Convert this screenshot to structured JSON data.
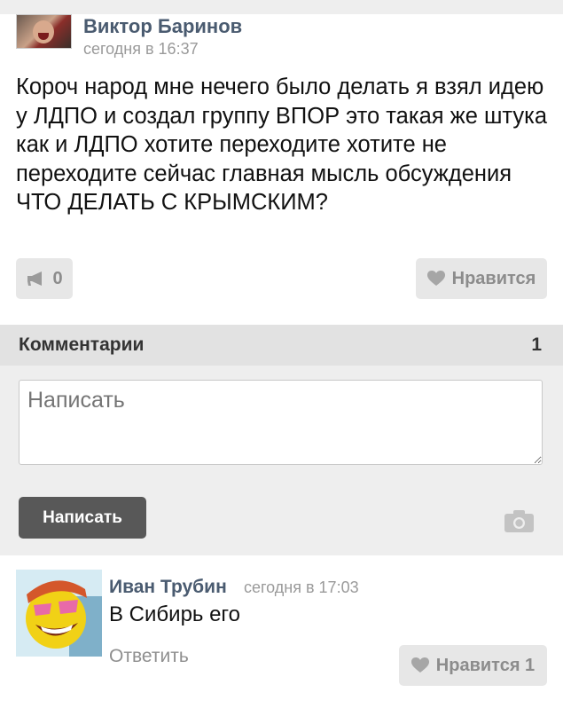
{
  "post": {
    "author": "Виктор Баринов",
    "time": "сегодня в 16:37",
    "text": "Короч народ мне нечего было делать я взял идею у ЛДПО и создал группу ВПОР это такая же штука как и ЛДПО хотите переходите хотите не переходите сейчас главная мысль обсуждения ЧТО ДЕЛАТЬ С КРЫМСКИМ?",
    "share_count": "0",
    "like_label": "Нравится",
    "icons": {
      "share": "megaphone-icon",
      "like": "heart-icon"
    }
  },
  "comments": {
    "title": "Комментарии",
    "count": "1",
    "input_placeholder": "Написать",
    "submit_label": "Написать",
    "attach_icon": "camera-icon"
  },
  "comment": {
    "author": "Иван Трубин",
    "time": "сегодня в 17:03",
    "text": "В Сибирь его",
    "reply_label": "Ответить",
    "like_label": "Нравится 1"
  },
  "colors": {
    "author_name": "#4a5b70",
    "button_bg": "#e7e7e7",
    "section_bg": "#eeeeee",
    "submit_bg": "#585858"
  }
}
